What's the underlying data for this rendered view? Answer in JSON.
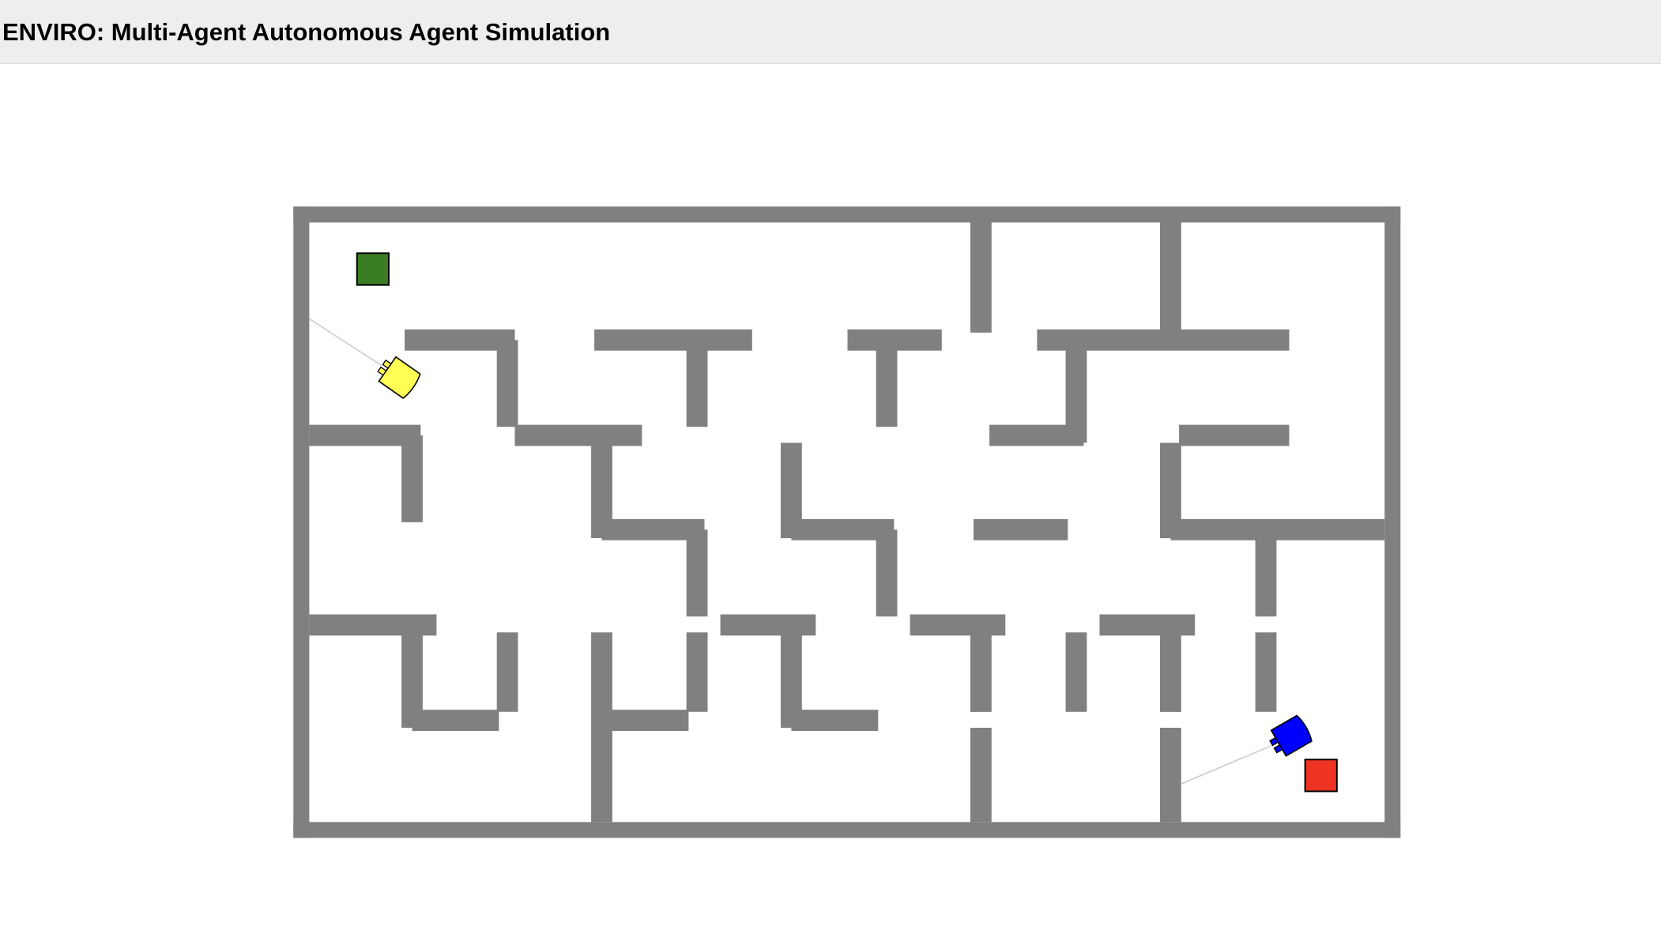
{
  "header": {
    "title": "ENVIRO: Multi-Agent Autonomous Agent Simulation"
  },
  "simulation": {
    "colors": {
      "wall": "#808080",
      "background": "#ffffff",
      "header_background": "#eeeeee",
      "sensor_ray": "#d0d0d0",
      "outline": "#000000"
    },
    "agents": [
      {
        "name": "yellow-agent",
        "color": "#ffff55",
        "icon": "robot-agent-icon"
      },
      {
        "name": "blue-agent",
        "color": "#0000ff",
        "icon": "robot-agent-icon"
      }
    ],
    "targets": [
      {
        "name": "green-target",
        "color": "#3a7d22"
      },
      {
        "name": "red-target",
        "color": "#ee3322"
      }
    ]
  }
}
